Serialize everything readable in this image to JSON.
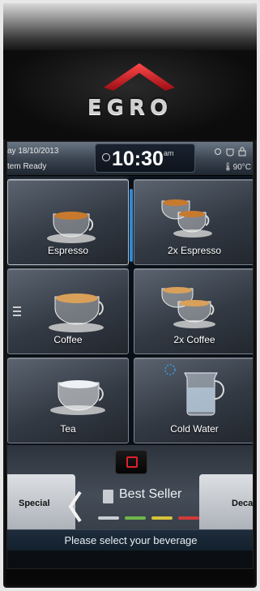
{
  "brand": {
    "logo_text": "EGRO",
    "accent": "#d01a24"
  },
  "status": {
    "date": "ay 18/10/2013",
    "state": "tem Ready",
    "time": "10:30",
    "ampm": "am",
    "temperature": "90°C",
    "icons": [
      "info-icon",
      "cup-icon",
      "lock-icon"
    ]
  },
  "beverages": [
    {
      "label": "Espresso",
      "icon": "espresso-cup-icon"
    },
    {
      "label": "2x Espresso",
      "icon": "double-espresso-cup-icon"
    },
    {
      "label": "Coffee",
      "icon": "coffee-cup-icon"
    },
    {
      "label": "2x Coffee",
      "icon": "double-coffee-cup-icon"
    },
    {
      "label": "Tea",
      "icon": "tea-cup-icon"
    },
    {
      "label": "Cold Water",
      "icon": "water-jug-icon"
    }
  ],
  "navigation": {
    "left_category": "Special",
    "right_category": "Decaffe",
    "current_category": "Best Seller",
    "indicator_colors": [
      "#c9ced4",
      "#6fb84a",
      "#d6c23a",
      "#d23a3a"
    ],
    "prompt": "Please select your beverage"
  }
}
